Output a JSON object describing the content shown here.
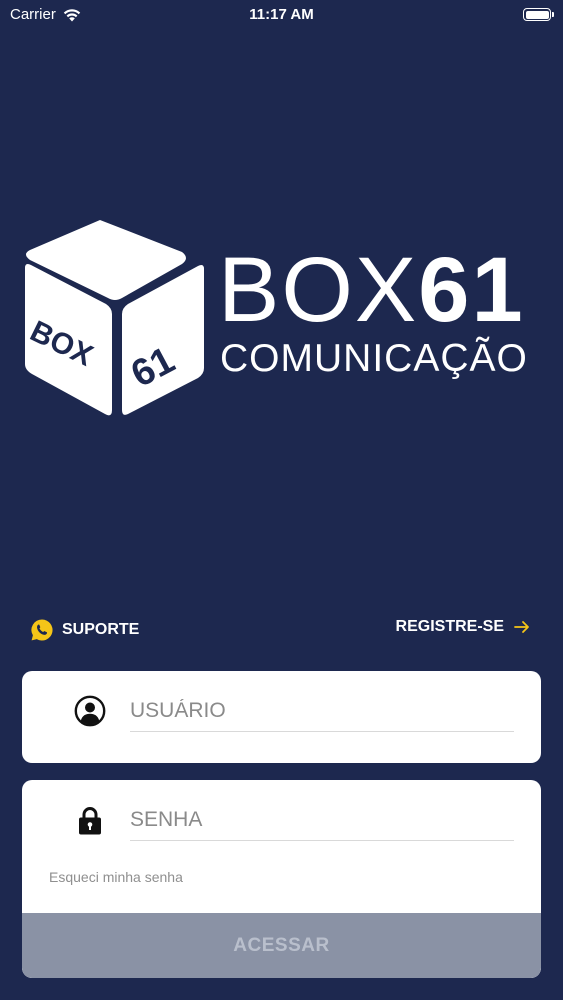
{
  "status_bar": {
    "carrier": "Carrier",
    "time": "11:17 AM",
    "wifi_icon": "wifi-icon",
    "battery_icon": "battery-icon"
  },
  "logo": {
    "cube_faces": {
      "left": "BOX",
      "right": "61"
    },
    "brand_thin": "BOX",
    "brand_bold": "61",
    "brand_sub": "COMUNICAÇÃO",
    "color": "#ffffff"
  },
  "links": {
    "support_label": "SUPORTE",
    "support_icon": "whatsapp-icon",
    "support_icon_color": "#f5c518",
    "register_label": "REGISTRE-SE",
    "register_icon": "arrow-right-icon",
    "register_icon_color": "#f5c518"
  },
  "form": {
    "username": {
      "placeholder": "USUÁRIO",
      "value": "",
      "icon": "user-icon"
    },
    "password": {
      "placeholder": "SENHA",
      "value": "",
      "icon": "lock-icon"
    },
    "forgot_label": "Esqueci minha senha",
    "submit_label": "ACESSAR"
  },
  "colors": {
    "background": "#1d284f",
    "card": "#ffffff",
    "submit_disabled": "#8a92a5",
    "accent": "#f5c518"
  }
}
